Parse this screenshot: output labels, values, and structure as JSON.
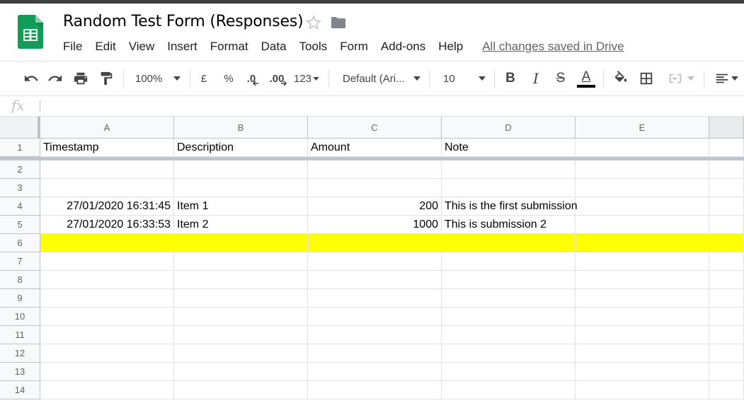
{
  "doc": {
    "title": "Random Test Form (Responses)",
    "saved_status": "All changes saved in Drive"
  },
  "menu": [
    "File",
    "Edit",
    "View",
    "Insert",
    "Format",
    "Data",
    "Tools",
    "Form",
    "Add-ons",
    "Help"
  ],
  "toolbar": {
    "zoom": "100%",
    "currency": "£",
    "percent": "%",
    "decrease_decimal": ".0",
    "increase_decimal": ".00",
    "more_formats": "123",
    "font": "Default (Ari...",
    "font_size": "10",
    "bold": "B",
    "italic": "I",
    "strikethrough": "S",
    "text_color": "A",
    "text_color_value": "#000000"
  },
  "formula_bar": {
    "fx_label": "fx",
    "value": ""
  },
  "sheet": {
    "columns": [
      "A",
      "B",
      "C",
      "D",
      "E"
    ],
    "rows": [
      "1",
      "2",
      "3",
      "4",
      "5",
      "6",
      "7",
      "8",
      "9",
      "10",
      "11",
      "12",
      "13",
      "14"
    ],
    "cells": [
      [
        "Timestamp",
        "Description",
        "Amount",
        "Note",
        ""
      ],
      [
        "",
        "",
        "",
        "",
        ""
      ],
      [
        "",
        "",
        "",
        "",
        ""
      ],
      [
        "27/01/2020 16:31:45",
        "Item 1",
        "200",
        "This is the first submission",
        ""
      ],
      [
        "27/01/2020 16:33:53",
        "Item 2",
        "1000",
        "This is submission 2",
        ""
      ],
      [
        "",
        "",
        "",
        "",
        ""
      ],
      [
        "",
        "",
        "",
        "",
        ""
      ],
      [
        "",
        "",
        "",
        "",
        ""
      ],
      [
        "",
        "",
        "",
        "",
        ""
      ],
      [
        "",
        "",
        "",
        "",
        ""
      ],
      [
        "",
        "",
        "",
        "",
        ""
      ],
      [
        "",
        "",
        "",
        "",
        ""
      ],
      [
        "",
        "",
        "",
        "",
        ""
      ],
      [
        "",
        "",
        "",
        "",
        ""
      ]
    ],
    "numeric_columns": [
      0,
      2
    ],
    "highlighted_row": 6,
    "highlight_color": "#ffff00",
    "frozen_rows": 1
  },
  "colors": {
    "sheets_green": "#0f9d58",
    "header_bg": "#f8f9fa"
  }
}
